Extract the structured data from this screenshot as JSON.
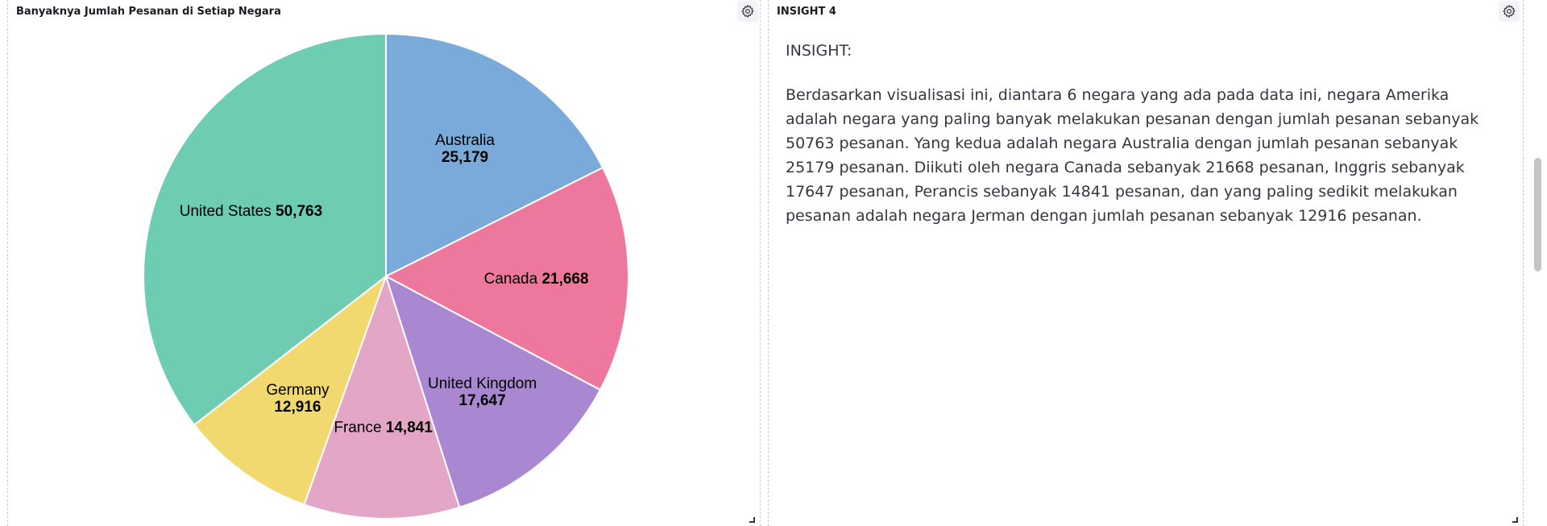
{
  "left_panel": {
    "title": "Banyaknya Jumlah Pesanan di Setiap Negara",
    "settings_icon": "gear-icon"
  },
  "right_panel": {
    "title": "INSIGHT 4",
    "settings_icon": "gear-icon",
    "heading": "INSIGHT:",
    "body": "Berdasarkan visualisasi ini, diantara 6 negara yang ada pada data ini, negara Amerika adalah negara yang paling banyak melakukan pesanan dengan jumlah pesanan sebanyak 50763 pesanan. Yang kedua adalah negara Australia dengan jumlah pesanan sebanyak 25179 pesanan. Diikuti oleh negara Canada sebanyak 21668 pesanan, Inggris sebanyak 17647 pesanan, Perancis sebanyak 14841 pesanan, dan yang paling sedikit melakukan pesanan adalah negara Jerman dengan jumlah pesanan sebanyak 12916 pesanan."
  },
  "chart_data": {
    "type": "pie",
    "title": "Banyaknya Jumlah Pesanan di Setiap Negara",
    "legend": "none",
    "labels_on_slices": true,
    "slices": [
      {
        "label": "Australia",
        "value": 25179,
        "display": "25,179",
        "color": "#79aad9"
      },
      {
        "label": "Canada",
        "value": 21668,
        "display": "21,668",
        "color": "#ee789d"
      },
      {
        "label": "United Kingdom",
        "value": 17647,
        "display": "17,647",
        "color": "#a987d1"
      },
      {
        "label": "France",
        "value": 14841,
        "display": "14,841",
        "color": "#e4a6c7"
      },
      {
        "label": "Germany",
        "value": 12916,
        "display": "12,916",
        "color": "#f1d86f"
      },
      {
        "label": "United States",
        "value": 50763,
        "display": "50,763",
        "color": "#6dccb1"
      }
    ]
  }
}
